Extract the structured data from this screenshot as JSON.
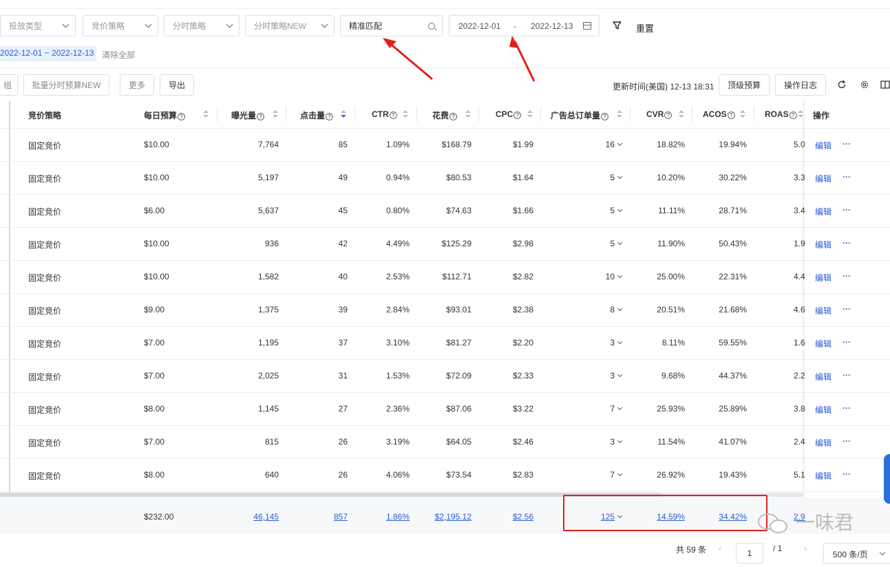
{
  "filters": {
    "placement_type": "投放类型",
    "bid_strategy": "竞价策略",
    "dayparting": "分时策略",
    "dayparting_new": "分时策略NEW",
    "match_value": "精准匹配",
    "date_start": "2022-12-01",
    "date_sep": "-",
    "date_end": "2022-12-13",
    "reset": "重置"
  },
  "chips": {
    "date_range": "2022-12-01 ~ 2022-12-13",
    "clear_all": "清除全部"
  },
  "toolbar": {
    "group_partial": "组",
    "batch_dayparting": "批量分时预算NEW",
    "more": "更多",
    "export": "导出",
    "updated": "更新时间(美国) 12-13 18:31",
    "top_budget": "顶级预算",
    "log": "操作日志"
  },
  "columns": {
    "bid_strategy": "竞价策略",
    "daily_budget": "每日预算",
    "impressions": "曝光量",
    "clicks": "点击量",
    "ctr": "CTR",
    "spend": "花费",
    "cpc": "CPC",
    "orders": "广告总订单量",
    "cvr": "CVR",
    "acos": "ACOS",
    "roas": "ROAS",
    "action": "操作",
    "help_glyph": "?"
  },
  "rows": [
    {
      "strategy": "固定竞价",
      "budget": "$10.00",
      "impressions": "7,764",
      "clicks": "85",
      "ctr": "1.09%",
      "spend": "$168.79",
      "cpc": "$1.99",
      "orders": "16",
      "cvr": "18.82%",
      "acos": "19.94%",
      "roas": "5.0"
    },
    {
      "strategy": "固定竞价",
      "budget": "$10.00",
      "impressions": "5,197",
      "clicks": "49",
      "ctr": "0.94%",
      "spend": "$80.53",
      "cpc": "$1.64",
      "orders": "5",
      "cvr": "10.20%",
      "acos": "30.22%",
      "roas": "3.3"
    },
    {
      "strategy": "固定竞价",
      "budget": "$6.00",
      "impressions": "5,637",
      "clicks": "45",
      "ctr": "0.80%",
      "spend": "$74.63",
      "cpc": "$1.66",
      "orders": "5",
      "cvr": "11.11%",
      "acos": "28.71%",
      "roas": "3.4"
    },
    {
      "strategy": "固定竞价",
      "budget": "$10.00",
      "impressions": "936",
      "clicks": "42",
      "ctr": "4.49%",
      "spend": "$125.29",
      "cpc": "$2.98",
      "orders": "5",
      "cvr": "11.90%",
      "acos": "50.43%",
      "roas": "1.9"
    },
    {
      "strategy": "固定竞价",
      "budget": "$10.00",
      "impressions": "1,582",
      "clicks": "40",
      "ctr": "2.53%",
      "spend": "$112.71",
      "cpc": "$2.82",
      "orders": "10",
      "cvr": "25.00%",
      "acos": "22.31%",
      "roas": "4.4"
    },
    {
      "strategy": "固定竞价",
      "budget": "$9.00",
      "impressions": "1,375",
      "clicks": "39",
      "ctr": "2.84%",
      "spend": "$93.01",
      "cpc": "$2.38",
      "orders": "8",
      "cvr": "20.51%",
      "acos": "21.68%",
      "roas": "4.6"
    },
    {
      "strategy": "固定竞价",
      "budget": "$7.00",
      "impressions": "1,195",
      "clicks": "37",
      "ctr": "3.10%",
      "spend": "$81.27",
      "cpc": "$2.20",
      "orders": "3",
      "cvr": "8.11%",
      "acos": "59.55%",
      "roas": "1.6"
    },
    {
      "strategy": "固定竞价",
      "budget": "$7.00",
      "impressions": "2,025",
      "clicks": "31",
      "ctr": "1.53%",
      "spend": "$72.09",
      "cpc": "$2.33",
      "orders": "3",
      "cvr": "9.68%",
      "acos": "44.37%",
      "roas": "2.2"
    },
    {
      "strategy": "固定竞价",
      "budget": "$8.00",
      "impressions": "1,145",
      "clicks": "27",
      "ctr": "2.36%",
      "spend": "$87.06",
      "cpc": "$3.22",
      "orders": "7",
      "cvr": "25.93%",
      "acos": "25.89%",
      "roas": "3.8"
    },
    {
      "strategy": "固定竞价",
      "budget": "$7.00",
      "impressions": "815",
      "clicks": "26",
      "ctr": "3.19%",
      "spend": "$64.05",
      "cpc": "$2.46",
      "orders": "3",
      "cvr": "11.54%",
      "acos": "41.07%",
      "roas": "2.4"
    },
    {
      "strategy": "固定竞价",
      "budget": "$8.00",
      "impressions": "640",
      "clicks": "26",
      "ctr": "4.06%",
      "spend": "$73.54",
      "cpc": "$2.83",
      "orders": "7",
      "cvr": "26.92%",
      "acos": "19.43%",
      "roas": "5.1"
    }
  ],
  "row_actions": {
    "edit": "编辑",
    "more": "···"
  },
  "totals": {
    "budget": "$232.00",
    "impressions": "46,145",
    "clicks": "857",
    "ctr": "1.86%",
    "spend": "$2,195.12",
    "cpc": "$2.56",
    "orders": "125",
    "cvr": "14.59%",
    "acos": "34.42%",
    "roas": "2.9"
  },
  "pagination": {
    "total": "共 59 条",
    "prev": "‹",
    "page": "1",
    "slash": "/ 1",
    "next": "›",
    "page_size": "500 条/页"
  },
  "watermark": "一味君",
  "colors": {
    "accent": "#2a5bd7",
    "annotation_red": "#e0211b"
  }
}
